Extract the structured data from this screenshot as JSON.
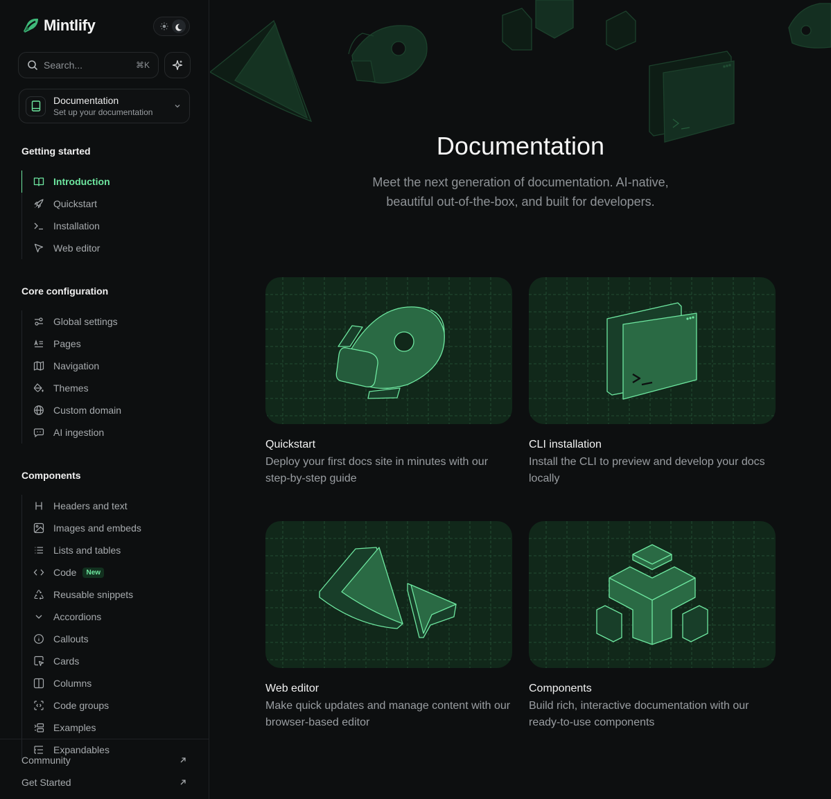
{
  "brand": {
    "name": "Mintlify",
    "accent": "#6ee7a0"
  },
  "theme_toggle": {
    "light_icon": "sun-icon",
    "dark_icon": "moon-icon",
    "selected": "dark"
  },
  "search": {
    "placeholder": "Search...",
    "shortcut": "⌘K"
  },
  "product_switcher": {
    "title": "Documentation",
    "subtitle": "Set up your documentation"
  },
  "nav": {
    "getting_started": {
      "title": "Getting started",
      "items": [
        {
          "label": "Introduction",
          "icon": "book-open-icon",
          "active": true
        },
        {
          "label": "Quickstart",
          "icon": "rocket-icon"
        },
        {
          "label": "Installation",
          "icon": "terminal-icon"
        },
        {
          "label": "Web editor",
          "icon": "pointer-icon"
        }
      ]
    },
    "core_configuration": {
      "title": "Core configuration",
      "items": [
        {
          "label": "Global settings",
          "icon": "sliders-icon"
        },
        {
          "label": "Pages",
          "icon": "text-align-icon"
        },
        {
          "label": "Navigation",
          "icon": "map-icon"
        },
        {
          "label": "Themes",
          "icon": "paint-bucket-icon"
        },
        {
          "label": "Custom domain",
          "icon": "globe-icon"
        },
        {
          "label": "AI ingestion",
          "icon": "bot-message-icon"
        }
      ]
    },
    "components": {
      "title": "Components",
      "items": [
        {
          "label": "Headers and text",
          "icon": "heading-icon"
        },
        {
          "label": "Images and embeds",
          "icon": "image-icon"
        },
        {
          "label": "Lists and tables",
          "icon": "list-icon"
        },
        {
          "label": "Code",
          "icon": "code-icon",
          "badge": "New"
        },
        {
          "label": "Reusable snippets",
          "icon": "recycle-icon"
        },
        {
          "label": "Accordions",
          "icon": "chevron-down-icon"
        },
        {
          "label": "Callouts",
          "icon": "info-icon"
        },
        {
          "label": "Cards",
          "icon": "card-pointer-icon"
        },
        {
          "label": "Columns",
          "icon": "columns-icon"
        },
        {
          "label": "Code groups",
          "icon": "scan-code-icon"
        },
        {
          "label": "Examples",
          "icon": "examples-icon"
        },
        {
          "label": "Expandables",
          "icon": "list-tree-icon"
        }
      ]
    }
  },
  "footer": {
    "links": [
      {
        "label": "Community",
        "icon": "arrow-up-right-icon"
      },
      {
        "label": "Get Started",
        "icon": "arrow-up-right-icon"
      }
    ]
  },
  "hero": {
    "title": "Documentation",
    "subtitle": "Meet the next generation of documentation. AI-native, beautiful out-of-the-box, and built for developers."
  },
  "cards": [
    {
      "title": "Quickstart",
      "description": "Deploy your first docs site in minutes with our step-by-step guide",
      "icon": "rocket-illustration"
    },
    {
      "title": "CLI installation",
      "description": "Install the CLI to preview and develop your docs locally",
      "icon": "terminal-window-illustration"
    },
    {
      "title": "Web editor",
      "description": "Make quick updates and manage content with our browser-based editor",
      "icon": "cursor-illustration"
    },
    {
      "title": "Components",
      "description": "Build rich, interactive documentation with our ready-to-use components",
      "icon": "blocks-illustration"
    }
  ]
}
